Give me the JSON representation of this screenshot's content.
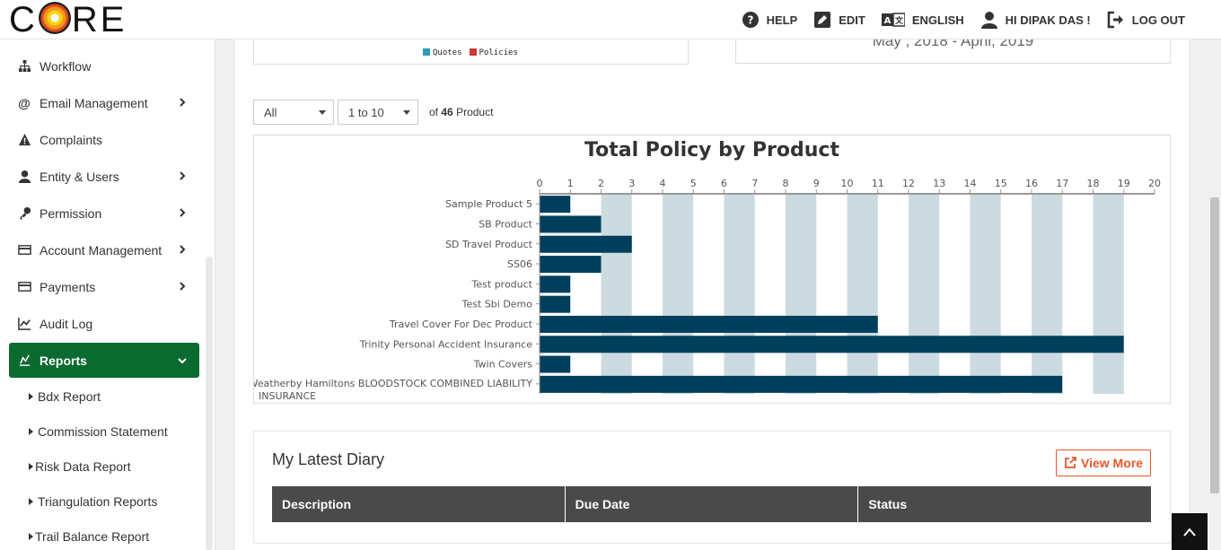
{
  "header": {
    "logo_left": "C",
    "logo_right": "RE",
    "nav": {
      "help": "HELP",
      "edit": "EDIT",
      "language": "ENGLISH",
      "user": "HI DIPAK DAS !",
      "logout": "LOG OUT"
    }
  },
  "sidebar": {
    "items": [
      {
        "label": "Workflow"
      },
      {
        "label": "Email Management"
      },
      {
        "label": "Complaints"
      },
      {
        "label": "Entity & Users"
      },
      {
        "label": "Permission"
      },
      {
        "label": "Account Management"
      },
      {
        "label": "Payments"
      },
      {
        "label": "Audit Log"
      },
      {
        "label": "Reports"
      }
    ],
    "sub_items": [
      {
        "label": "Bdx Report"
      },
      {
        "label": "Commission Statement"
      },
      {
        "label": "Risk Data Report"
      },
      {
        "label": "Triangulation Reports"
      },
      {
        "label": "Trail Balance Report"
      }
    ]
  },
  "top_cards": {
    "legend_quotes": "Quotes",
    "legend_policies": "Policies",
    "date_range": "May , 2018 - April, 2019"
  },
  "filters": {
    "category": "All",
    "range": "1 to 10",
    "count_prefix": "of",
    "count": "46",
    "count_suffix": "Product"
  },
  "chart_data": {
    "type": "bar",
    "orientation": "horizontal",
    "title": "Total Policy by Product",
    "categories": [
      "Sample Product 5",
      "SB Product",
      "SD Travel Product",
      "SS06",
      "Test product",
      "Test Sbi Demo",
      "Travel Cover For Dec Product",
      "Trinity Personal Accident Insurance",
      "Twin Covers",
      "Weatherby Hamiltons BLOODSTOCK COMBINED LIABILITY INSURANCE"
    ],
    "values": [
      1,
      2,
      3,
      2,
      1,
      1,
      11,
      19,
      1,
      17
    ],
    "xlim": [
      0,
      20
    ],
    "ticks": [
      0,
      1,
      2,
      3,
      4,
      5,
      6,
      7,
      8,
      9,
      10,
      11,
      12,
      13,
      14,
      15,
      16,
      17,
      18,
      19,
      20
    ],
    "bar_color": "#003f5c",
    "band_color": "#ccdbe0"
  },
  "diary": {
    "title": "My Latest Diary",
    "view_more": "View More",
    "columns": [
      "Description",
      "Due Date",
      "Status"
    ]
  }
}
